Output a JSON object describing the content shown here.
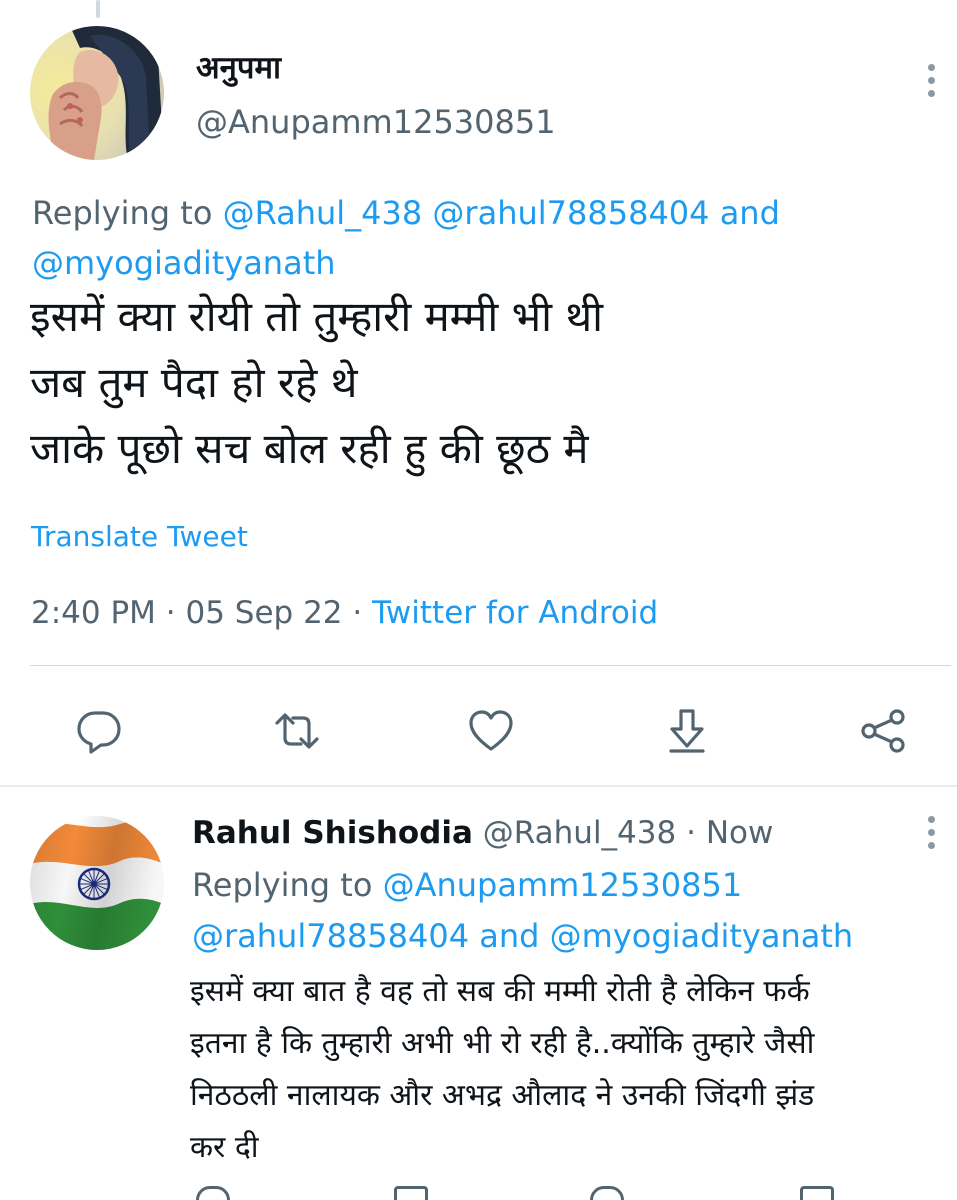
{
  "main_tweet": {
    "display_name": "अनुपमा",
    "handle": "@Anupamm12530851",
    "replying_prefix": "Replying to",
    "replying_mentions": [
      "@Rahul_438",
      "@rahul78858404"
    ],
    "replying_conjunction": "and",
    "replying_last": "@myogiadityanath",
    "text_lines": [
      "इसमें क्या रोयी तो तुम्हारी  मम्मी भी थी",
      "जब तुम पैदा हो रहे थे",
      "जाके पूछो सच बोल रही हु की छूठ मै"
    ],
    "translate_label": "Translate Tweet",
    "time": "2:40 PM",
    "separator": "·",
    "date": "05 Sep 22",
    "source": "Twitter for Android"
  },
  "actions": {
    "icons": [
      "reply-icon",
      "retweet-icon",
      "like-icon",
      "download-icon",
      "share-icon"
    ]
  },
  "reply_tweet": {
    "display_name": "Rahul Shishodia",
    "handle": "@Rahul_438",
    "separator": "·",
    "time": "Now",
    "replying_prefix": "Replying to",
    "replying_mentions": [
      "@Anupamm12530851",
      "@rahul78858404"
    ],
    "replying_conjunction": "and",
    "replying_last": "@myogiadityanath",
    "text_lines": [
      "इसमें क्या बात है वह तो सब की मम्मी रोती है लेकिन फर्क",
      "इतना है कि तुम्हारी अभी भी रो रही है..क्योंकि तुम्हारे जैसी",
      "निठठली नालायक और अभद्र औलाद ने उनकी जिंदगी झंड",
      "कर दी"
    ]
  },
  "colors": {
    "accent": "#1d9bf0",
    "secondary_text": "#536471",
    "primary_text": "#0f1419",
    "divider": "#cfd9de"
  }
}
